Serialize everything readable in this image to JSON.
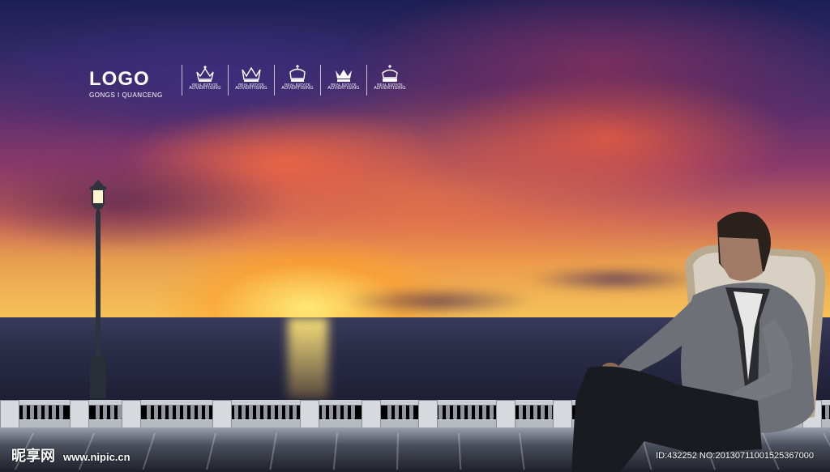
{
  "logo": {
    "title": "LOGO",
    "subtitle": "GONGS I QUANCENG"
  },
  "badges": [
    {
      "icon": "crown-icon",
      "line1": "REAL ESTATE",
      "line2": "ADVERTISING"
    },
    {
      "icon": "crown-icon",
      "line1": "REAL ESTATE",
      "line2": "ADVERTISING"
    },
    {
      "icon": "crown-icon",
      "line1": "REAL ESTATE",
      "line2": "ADVERTISING"
    },
    {
      "icon": "crown-icon",
      "line1": "REAL ESTATE",
      "line2": "ADVERTISING"
    },
    {
      "icon": "crown-icon",
      "line1": "REAL ESTATE",
      "line2": "ADVERTISING"
    }
  ],
  "watermark": {
    "brand": "昵享网",
    "url": "www.nipic.cn",
    "id_text": "ID:432252 NO:20130711001525367000"
  },
  "colors": {
    "sky_top": "#1d1f55",
    "sunset": "#f7c45a",
    "sea": "#2a2c48"
  }
}
